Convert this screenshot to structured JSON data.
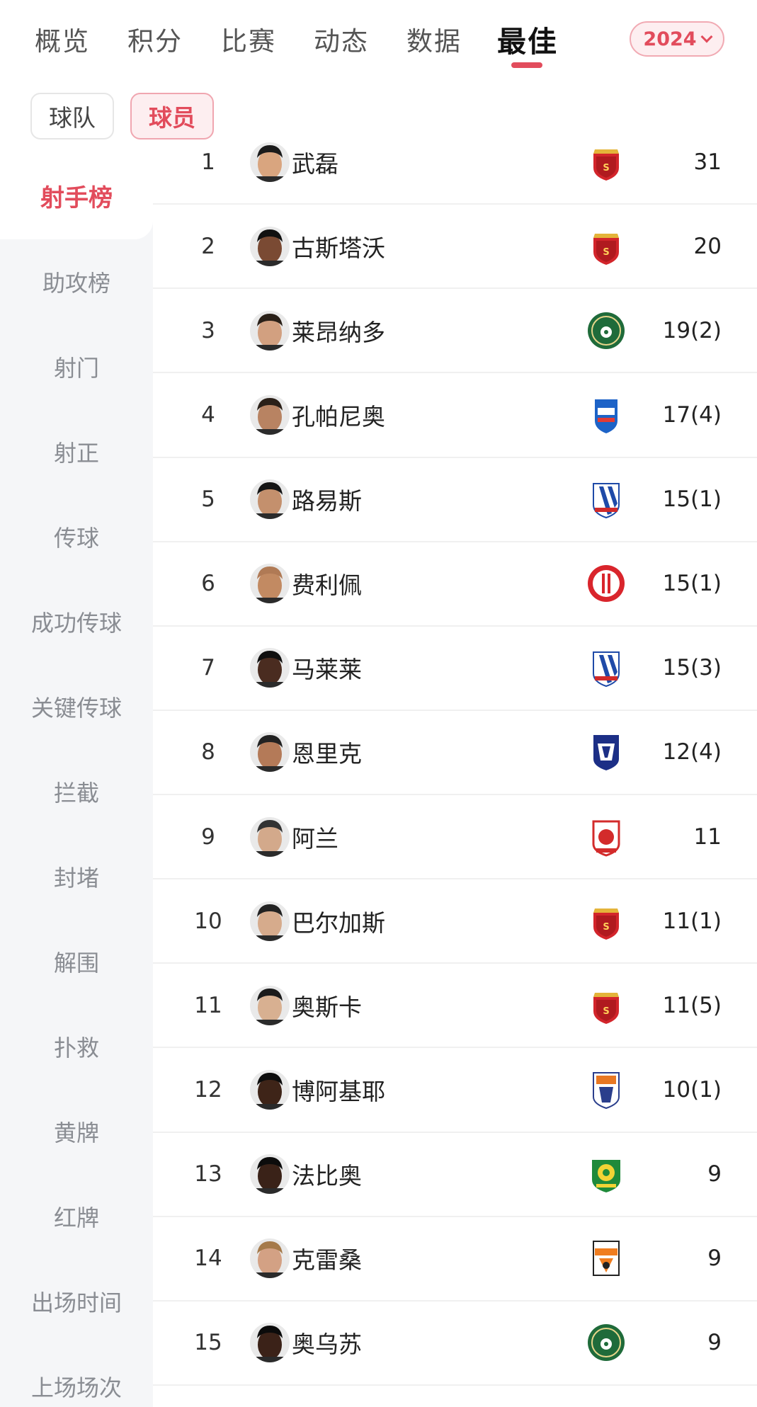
{
  "top_tabs": [
    "概览",
    "积分",
    "比赛",
    "动态",
    "数据",
    "最佳"
  ],
  "active_tab": "最佳",
  "season": "2024",
  "segments": {
    "team": "球队",
    "player": "球员"
  },
  "sidebar": {
    "items": [
      "射手榜",
      "助攻榜",
      "射门",
      "射正",
      "传球",
      "成功传球",
      "关键传球",
      "拦截",
      "封堵",
      "解围",
      "扑救",
      "黄牌",
      "红牌",
      "出场时间",
      "上场场次"
    ]
  },
  "colors": {
    "accent": "#e24c5c",
    "sidebar_bg": "#f5f6f8"
  },
  "players": [
    {
      "rank": "1",
      "name": "武磊",
      "value": "31",
      "team_badge": "shanghai-port-badge",
      "skin": "#d9a57f",
      "hair": "#1b1b1b"
    },
    {
      "rank": "2",
      "name": "古斯塔沃",
      "value": "20",
      "team_badge": "shanghai-port-badge",
      "skin": "#7a4a33",
      "hair": "#111"
    },
    {
      "rank": "3",
      "name": "莱昂纳多",
      "value": "19(2)",
      "team_badge": "zhejiang-badge",
      "skin": "#d2a080",
      "hair": "#2a2018"
    },
    {
      "rank": "4",
      "name": "孔帕尼奥",
      "value": "17(4)",
      "team_badge": "meizhou-badge",
      "skin": "#b88362",
      "hair": "#2b2018"
    },
    {
      "rank": "5",
      "name": "路易斯",
      "value": "15(1)",
      "team_badge": "shenhua-badge",
      "skin": "#c4906d",
      "hair": "#151515"
    },
    {
      "rank": "6",
      "name": "费利佩",
      "value": "15(1)",
      "team_badge": "chengdu-badge",
      "skin": "#c28a62",
      "hair": "#b07a55"
    },
    {
      "rank": "7",
      "name": "马莱莱",
      "value": "15(3)",
      "team_badge": "shenhua-badge",
      "skin": "#4a2c20",
      "hair": "#0f0f0f"
    },
    {
      "rank": "8",
      "name": "恩里克",
      "value": "12(4)",
      "team_badge": "wuhan-badge",
      "skin": "#b47a58",
      "hair": "#222"
    },
    {
      "rank": "9",
      "name": "阿兰",
      "value": "11",
      "team_badge": "qingdao-badge",
      "skin": "#d3a98b",
      "hair": "#333"
    },
    {
      "rank": "10",
      "name": "巴尔加斯",
      "value": "11(1)",
      "team_badge": "shanghai-port-badge",
      "skin": "#d6ab8c",
      "hair": "#222"
    },
    {
      "rank": "11",
      "name": "奥斯卡",
      "value": "11(5)",
      "team_badge": "shanghai-port-badge",
      "skin": "#d8b091",
      "hair": "#1b1b1b"
    },
    {
      "rank": "12",
      "name": "博阿基耶",
      "value": "10(1)",
      "team_badge": "shenzhen-badge",
      "skin": "#3e2418",
      "hair": "#0c0c0c"
    },
    {
      "rank": "13",
      "name": "法比奥",
      "value": "9",
      "team_badge": "guoan-badge",
      "skin": "#3a2218",
      "hair": "#0c0c0c"
    },
    {
      "rank": "14",
      "name": "克雷桑",
      "value": "9",
      "team_badge": "taishan-badge",
      "skin": "#d3a184",
      "hair": "#a57a4a"
    },
    {
      "rank": "15",
      "name": "奥乌苏",
      "value": "9",
      "team_badge": "zhejiang-badge",
      "skin": "#3b2218",
      "hair": "#0b0b0b"
    }
  ]
}
